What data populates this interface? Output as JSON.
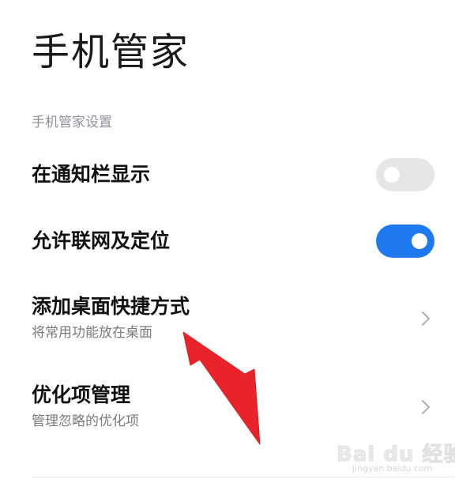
{
  "page": {
    "title": "手机管家"
  },
  "section": {
    "header": "手机管家设置"
  },
  "settings": [
    {
      "title": "在通知栏显示",
      "control": "toggle",
      "state": "off"
    },
    {
      "title": "允许联网及定位",
      "control": "toggle",
      "state": "on"
    },
    {
      "title": "添加桌面快捷方式",
      "subtitle": "将常用功能放在桌面",
      "control": "chevron"
    },
    {
      "title": "优化项管理",
      "subtitle": "管理忽略的优化项",
      "control": "chevron"
    }
  ],
  "watermark": {
    "brand": "Bai du 经验",
    "url": "jingyan.baidu.com"
  },
  "colors": {
    "accent": "#1e79f0",
    "toggle_off": "#e6e6e6",
    "annotation_arrow": "#e8232a",
    "section_header": "#8f8f9f"
  },
  "icons": {
    "chevron": "chevron-right-icon",
    "annotation": "red-arrow-annotation"
  }
}
